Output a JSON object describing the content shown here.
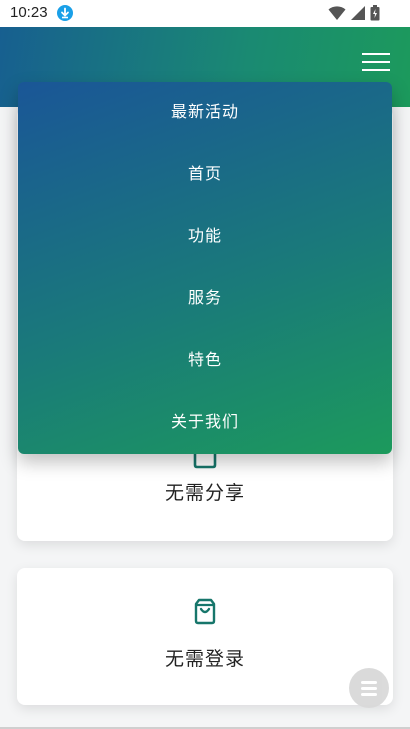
{
  "status_bar": {
    "time": "10:23",
    "download_icon": "download-icon",
    "wifi_icon": "wifi-icon",
    "signal_icon": "cell-signal-icon",
    "battery_icon": "battery-icon"
  },
  "header": {
    "menu_icon": "hamburger-menu-icon",
    "gradient": [
      "#175f90",
      "#1c9a5c"
    ]
  },
  "menu": {
    "items": [
      "最新活动",
      "首页",
      "功能",
      "服务",
      "特色",
      "关于我们"
    ],
    "gradient": [
      "#1a5697",
      "#1c9a5c"
    ]
  },
  "cards": [
    {
      "title": "无需分享",
      "icon": "badge-icon"
    },
    {
      "title": "无需登录",
      "icon": "shopping-bag-icon"
    }
  ],
  "fab": {
    "icon": "menu-icon"
  },
  "colors": {
    "accent": "#1a7a7a",
    "icon": "#17766b"
  }
}
